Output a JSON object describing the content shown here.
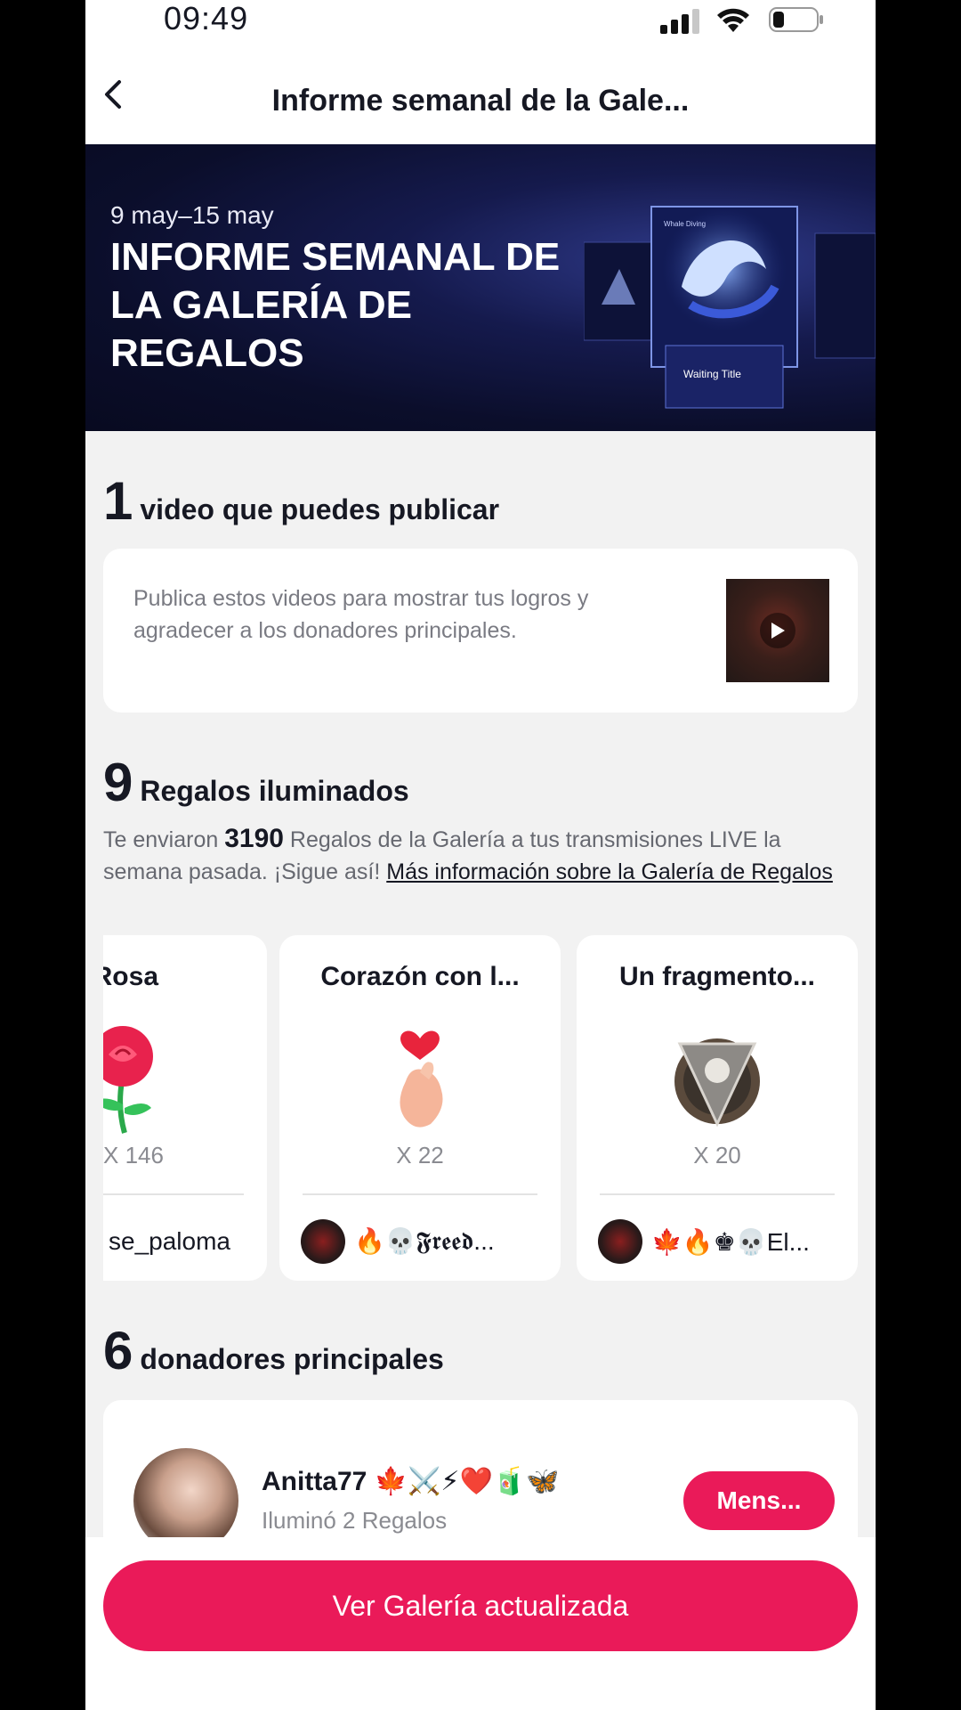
{
  "status_bar": {
    "time": "09:49"
  },
  "header": {
    "title": "Informe semanal de la Gale..."
  },
  "banner": {
    "date_range": "9 may–15 may",
    "title": "INFORME SEMANAL DE LA GALERÍA DE REGALOS",
    "art_label_top": "Whale Diving",
    "art_label_bottom": "Waiting Title"
  },
  "videos_section": {
    "count": "1",
    "title": "video que puedes publicar",
    "description": "Publica estos videos para mostrar tus logros y agradecer a los donadores principales."
  },
  "gifts_section": {
    "count": "9",
    "title": "Regalos iluminados",
    "desc_prefix": "Te enviaron ",
    "total_gifts": "3190",
    "desc_middle": " Regalos de la Galería a tus transmisiones LIVE la semana pasada. ¡Sigue así! ",
    "link": "Más información sobre la Galería de Regalos",
    "items": [
      {
        "name": "Rosa",
        "count": "X 146",
        "top_user": "se_paloma"
      },
      {
        "name": "Corazón con l...",
        "count": "X 22",
        "top_user": "🔥💀𝕱𝖗𝖊𝖊𝖉..."
      },
      {
        "name": "Un fragmento...",
        "count": "X 20",
        "top_user": "🍁🔥♚💀El..."
      }
    ]
  },
  "donors_section": {
    "count": "6",
    "title": "donadores principales",
    "donors": [
      {
        "name": "Anitta77 🍁⚔️⚡❤️🧃🦋",
        "subtitle": "Iluminó 2 Regalos",
        "button": "Mens..."
      }
    ]
  },
  "footer": {
    "cta": "Ver Galería actualizada"
  },
  "colors": {
    "accent": "#ea1a59",
    "banner_bg": "#0b0e2b"
  }
}
